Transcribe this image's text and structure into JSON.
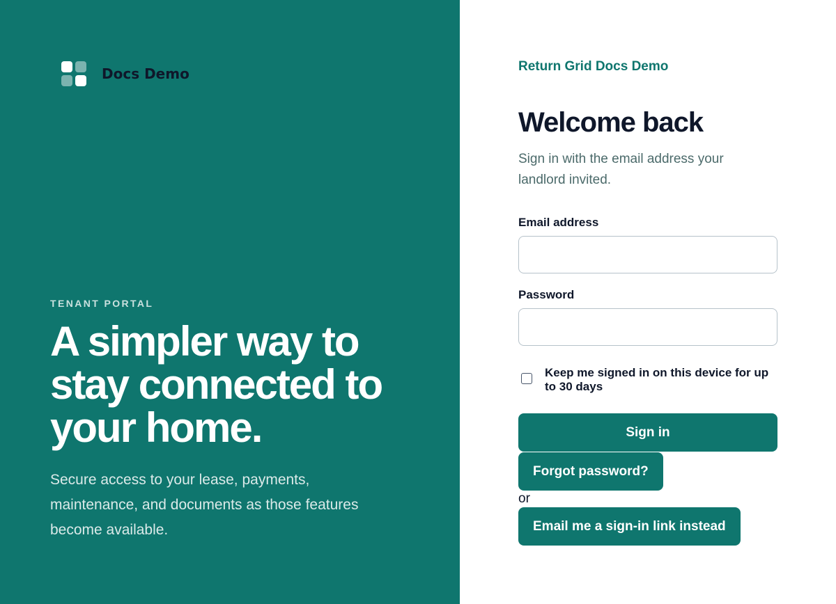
{
  "brand": {
    "name": "Docs Demo"
  },
  "hero": {
    "eyebrow": "TENANT PORTAL",
    "headline": "A simpler way to stay connected to your home.",
    "description": "Secure access to your lease, payments, maintenance, and documents as those features become available."
  },
  "auth": {
    "return_link": "Return Grid Docs Demo",
    "title": "Welcome back",
    "subtitle": "Sign in with the email address your landlord invited.",
    "email_label": "Email address",
    "email_value": "",
    "password_label": "Password",
    "password_value": "",
    "remember_label": "Keep me signed in on this device for up to 30 days",
    "remember_checked": false,
    "signin_label": "Sign in",
    "forgot_label": "Forgot password?",
    "or_text": "or",
    "magic_link_label": "Email me a sign-in link instead"
  },
  "colors": {
    "brand_teal": "#0f766e",
    "heading_dark": "#0f172a",
    "muted_text": "#4b6a6a",
    "input_border": "#b6c2ca"
  }
}
